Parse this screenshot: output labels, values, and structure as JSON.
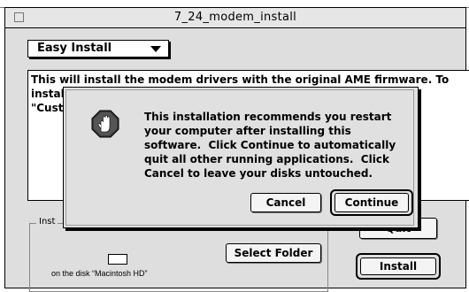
{
  "window": {
    "title": "7_24_modem_install"
  },
  "installer": {
    "install_type": "Easy Install",
    "description": "This will install the modem drivers with the original AME firmware. To\ninstal                                                                   hoose\n\"Cust",
    "location_group_label": "Inst",
    "disk_caption": "on the disk “Macintosh HD”",
    "select_folder_label": "Select Folder",
    "quit_label": "Quit",
    "install_label": "Install"
  },
  "alert": {
    "icon": "stop-hand-icon",
    "message": "This installation recommends you restart\nyour computer after installing this\nsoftware.  Click Continue to automatically\nquit all other running applications.  Click\nCancel to leave your disks untouched.",
    "cancel_label": "Cancel",
    "continue_label": "Continue"
  },
  "colors": {
    "window_bg": "#dedede",
    "dialog_bg": "#e0e0e0",
    "icon_dark": "#3a3a3a"
  }
}
